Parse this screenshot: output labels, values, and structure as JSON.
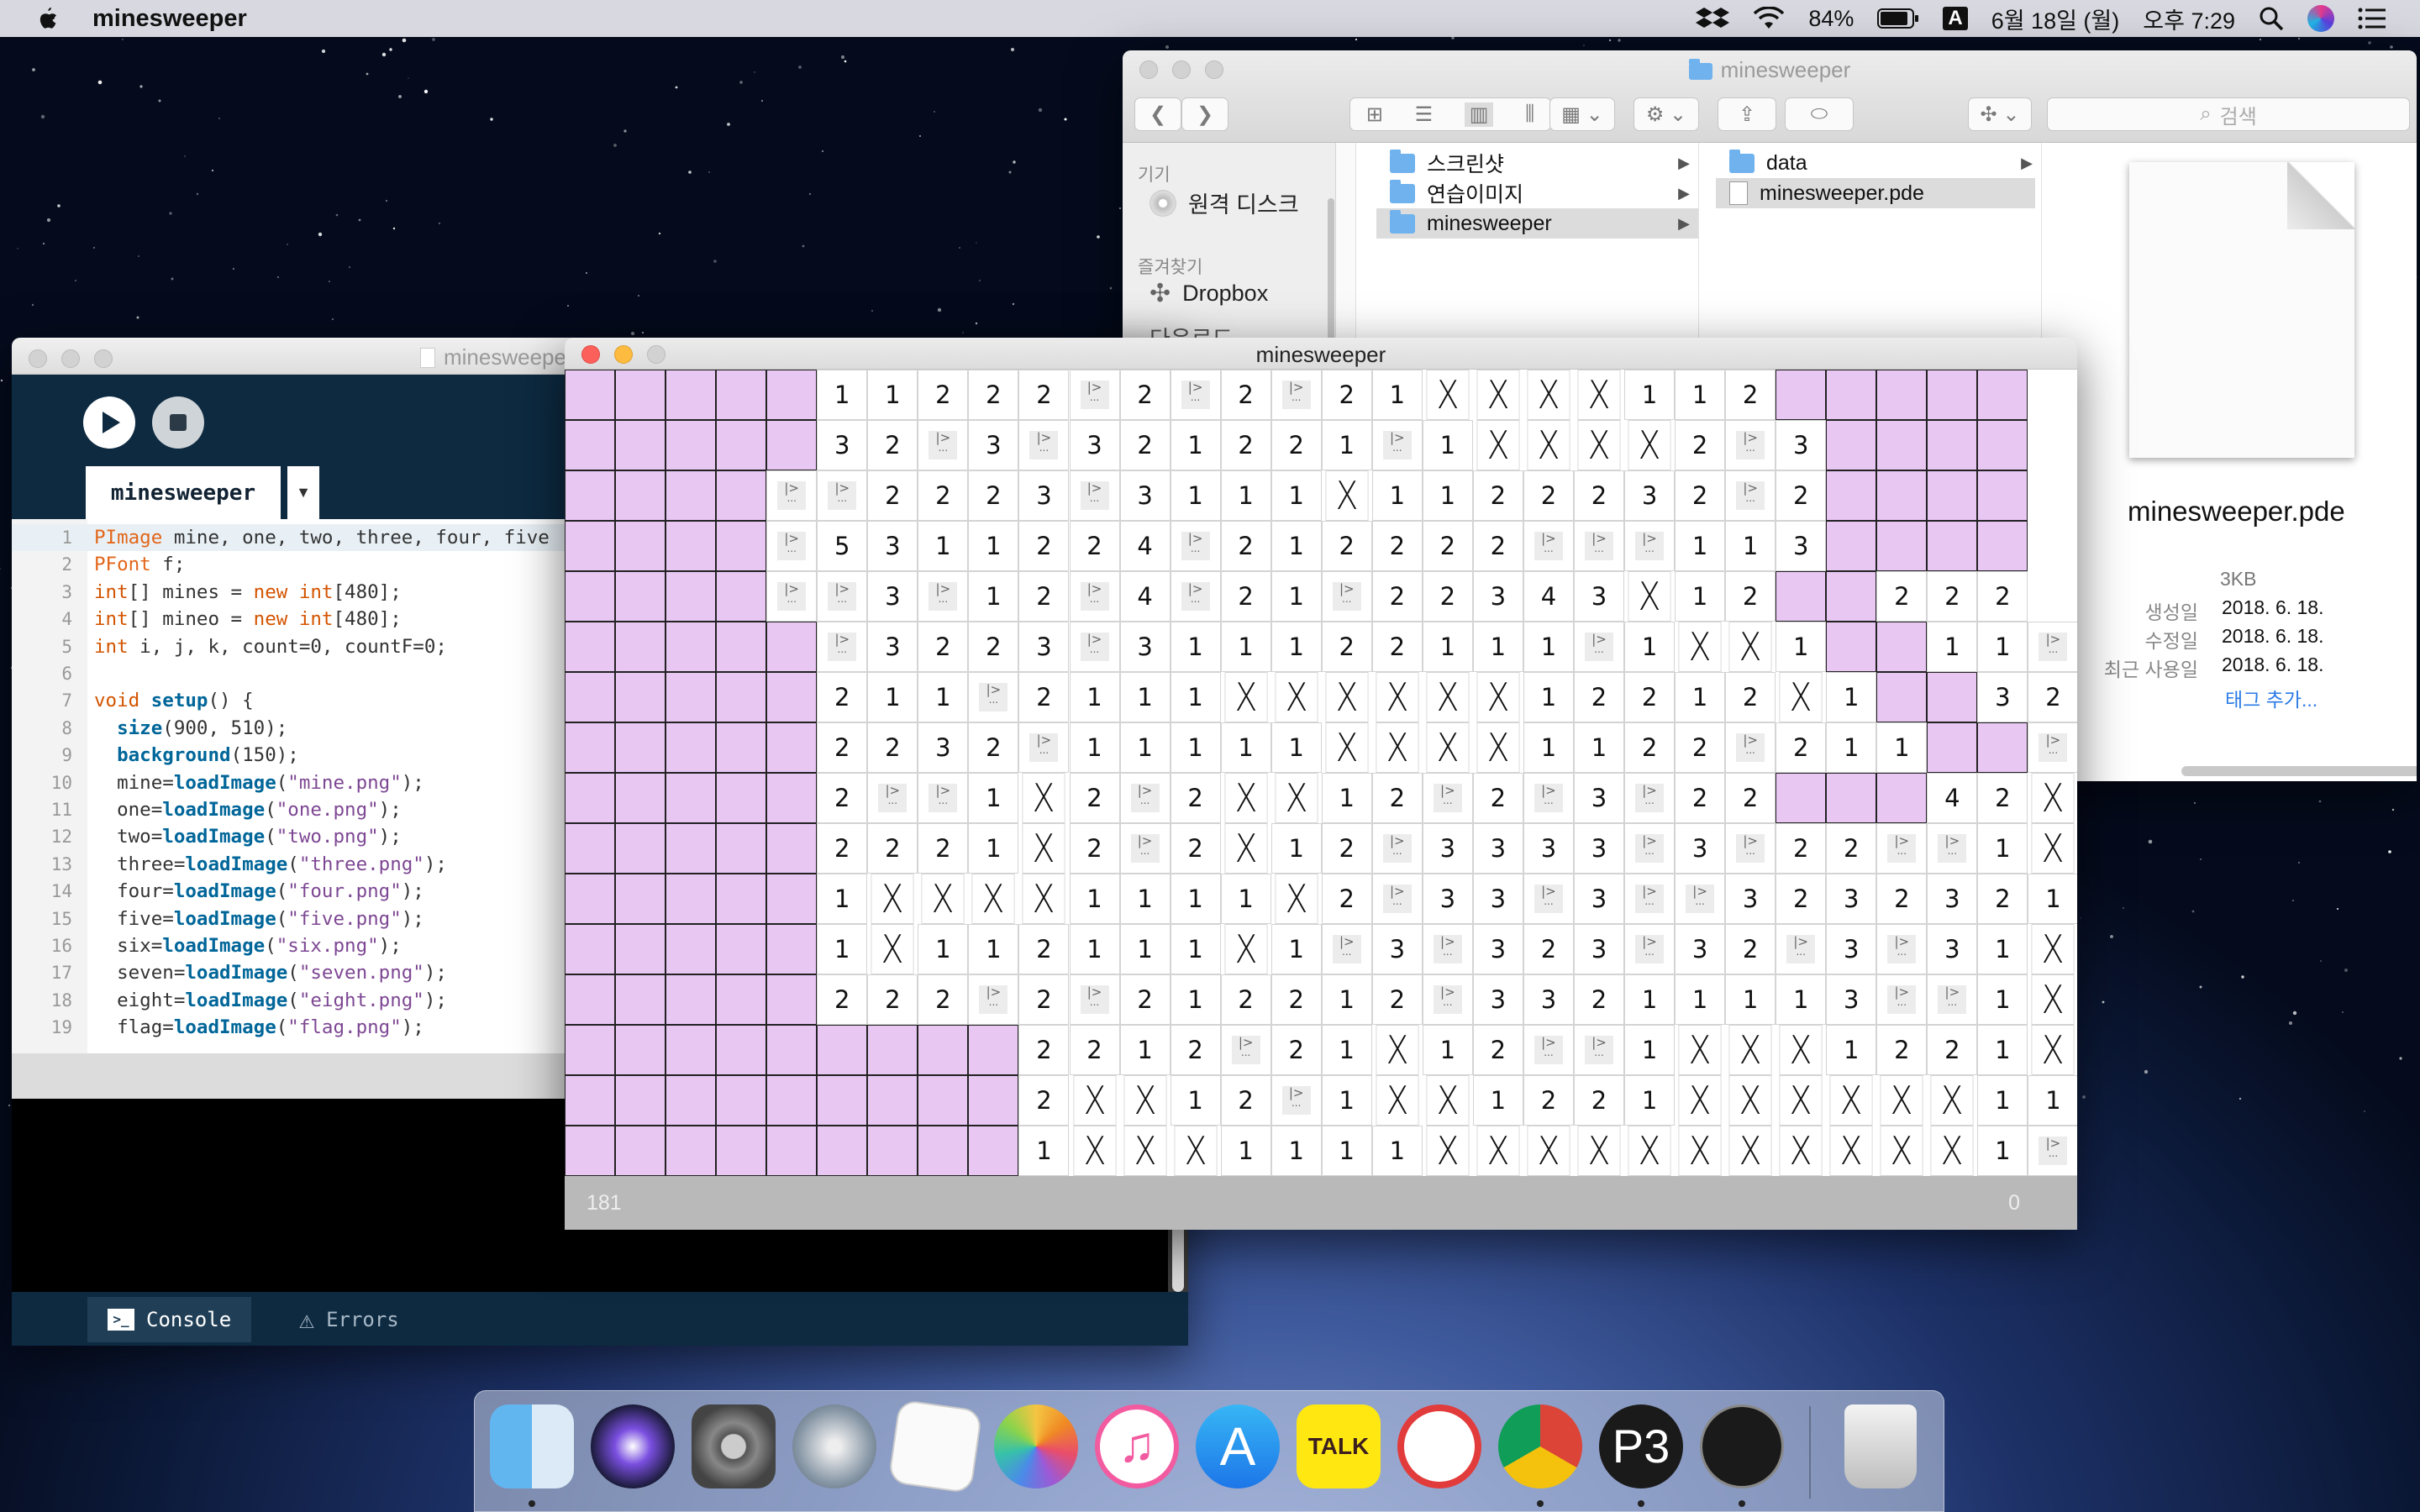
{
  "menubar": {
    "app_name": "minesweeper",
    "battery": "84%",
    "input_source": "A",
    "date": "6월 18일 (월)",
    "time": "오후 7:29"
  },
  "finder": {
    "title": "minesweeper",
    "search_placeholder": "검색",
    "sidebar": {
      "section_devices": "기기",
      "remote_disk": "원격 디스크",
      "section_favorites": "즐겨찾기",
      "dropbox": "Dropbox",
      "cut_item": "다운로드"
    },
    "col1": [
      "스크린샷",
      "연습이미지",
      "minesweeper"
    ],
    "col2": [
      "data",
      "minesweeper.pde"
    ],
    "preview": {
      "name": "minesweeper.pde",
      "size": "3KB",
      "created_label": "생성일",
      "created": "2018. 6. 18.",
      "modified_label": "수정일",
      "modified": "2018. 6. 18.",
      "lastused_label": "최근 사용일",
      "lastused": "2018. 6. 18.",
      "add_tag": "태그 추가..."
    }
  },
  "editor": {
    "title": "minesweeper",
    "tab": "minesweeper",
    "console_tab": "Console",
    "errors_tab": "Errors",
    "code_lines": [
      "PImage mine, one, two, three, four, five",
      "PFont f;",
      "int[] mines = new int[480];",
      "int[] mineo = new int[480];",
      "int i, j, k, count=0, countF=0;",
      "",
      "void setup() {",
      "  size(900, 510);",
      "  background(150);",
      "  mine=loadImage(\"mine.png\");",
      "  one=loadImage(\"one.png\");",
      "  two=loadImage(\"two.png\");",
      "  three=loadImage(\"three.png\");",
      "  four=loadImage(\"four.png\");",
      "  five=loadImage(\"five.png\");",
      "  six=loadImage(\"six.png\");",
      "  seven=loadImage(\"seven.png\");",
      "  eight=loadImage(\"eight.png\");",
      "  flag=loadImage(\"flag.png\");"
    ]
  },
  "game": {
    "title": "minesweeper",
    "status_left": "181",
    "status_right": "0",
    "legend": {
      "P": "unrevealed",
      "W": "revealed-empty",
      "F": "flag",
      "X": "mine"
    },
    "grid": [
      "PPPPP11222F2F2F21XXXX112PPPPP",
      "PPPPP32F3F321221F1XXXX2F3PPPP",
      "PPPPFF2223F3111X1122232F2PPPP",
      "PPPPF5311224F212222FFF113PPPP",
      "PPPPFF3F12F4F21F22343X12PP222",
      "PPPPPF3223F311122111F1XX1PP11F",
      "PPPPP211F2111XXXXXX12212X1PP321",
      "PPPPP2232F11111XXXX1122F211PPF1X",
      "PPPPP2FF1X2F2XX12F2F3F22PPP42X",
      "PPPPP2221X2F2X12F3333F3F22FF1X",
      "PPPPP1XXXX1111X2F33F3FF3232321X",
      "PPPPP1X112111X1F3F323F32F3F31XX",
      "PPPPP222F2F212212F33211113FF1XX",
      "PPPPPPPPP2212F21X12FF1XXX1221XX",
      "PPPPPPPPP2XX12F1XX1221XXXXXX11X",
      "PPPPPPPPP1XXX1111XXXXXXXXXXX1F1X"
    ]
  }
}
